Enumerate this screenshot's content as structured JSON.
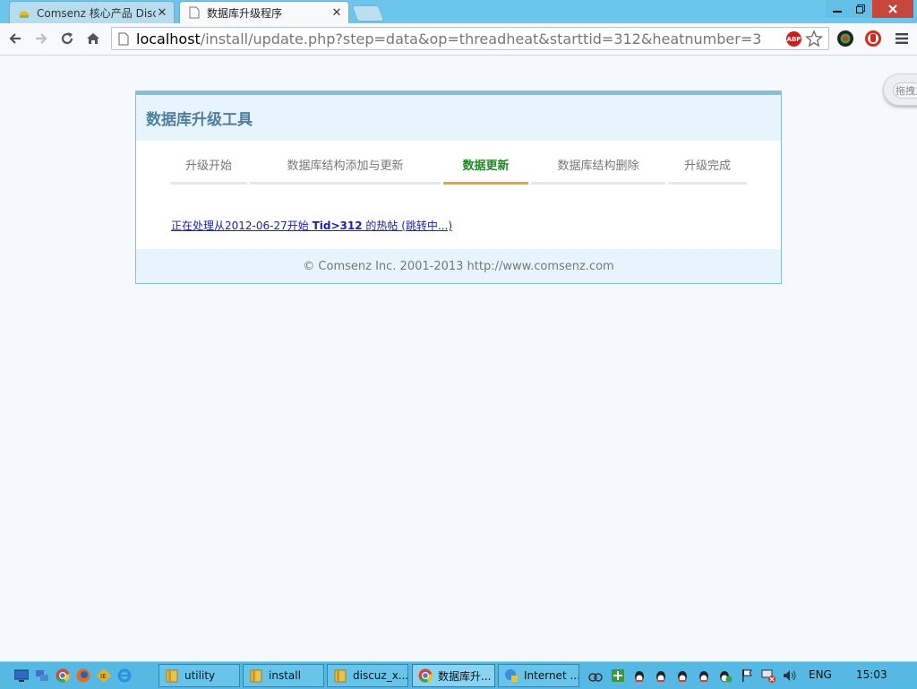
{
  "browser": {
    "tabs": [
      {
        "title": "Comsenz 核心产品 Discu",
        "active": false
      },
      {
        "title": "数据库升级程序",
        "active": true
      }
    ],
    "url_host": "localhost",
    "url_rest": "/install/update.php?step=data&op=threadheat&starttid=312&heatnumber=3",
    "abp_label": "ABP",
    "icons": [
      "back-icon",
      "forward-icon",
      "reload-icon",
      "home-icon",
      "page-icon",
      "star-icon",
      "camera-extension-icon",
      "stop-extension-icon",
      "menu-icon"
    ]
  },
  "sidebar_cloud": {
    "label": "拖拽文"
  },
  "panel": {
    "title": "数据库升级工具",
    "steps": [
      "升级开始",
      "数据库结构添加与更新",
      "数据更新",
      "数据库结构删除",
      "升级完成"
    ],
    "current_step": 2,
    "progress": {
      "prefix": "正在处理从2012-06-27开始 ",
      "bold": "Tid>312",
      "suffix": " 的热帖 (跳转中...)"
    },
    "footer": "© Comsenz Inc. 2001-2013 http://www.comsenz.com"
  },
  "taskbar": {
    "tasks": [
      {
        "label": "utility"
      },
      {
        "label": "install"
      },
      {
        "label": "discuz_x..."
      },
      {
        "label": "数据库升..."
      },
      {
        "label": "Internet ..."
      }
    ],
    "language": "ENG",
    "time": "15:03"
  },
  "colors": {
    "accent": "#86c0d8",
    "current_step": "#1f8a22",
    "current_underline": "#f0a424",
    "link": "#1a22b0",
    "title_bar": "#6cc6ec",
    "taskbar": "#56b9e4"
  }
}
